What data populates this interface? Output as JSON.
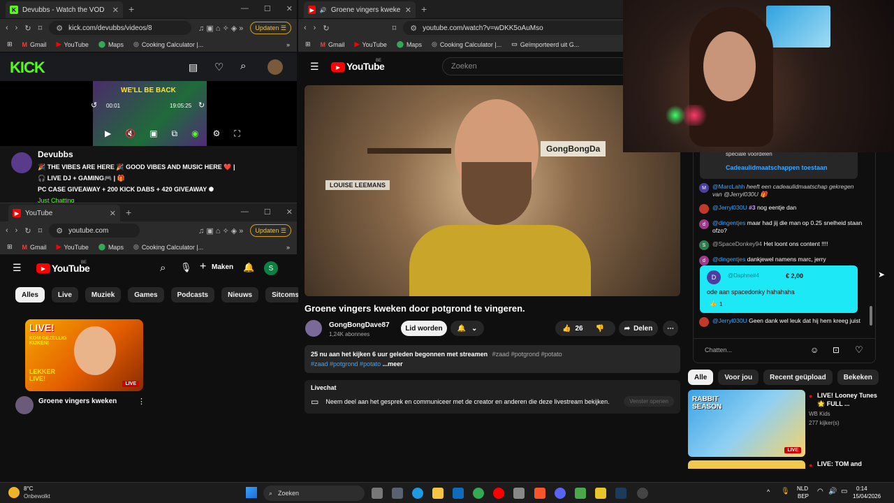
{
  "kick_window": {
    "tab_title": "Devubbs - Watch the VOD on Ki",
    "url": "kick.com/devubbs/videos/8",
    "update_label": "Updaten",
    "bookmarks": [
      "Gmail",
      "YouTube",
      "Maps",
      "Cooking Calculator |..."
    ],
    "logo": "KICK",
    "player_time_left": "00:01",
    "player_time_right": "19:05:25",
    "overlay_text": "WE'LL BE BACK",
    "channel_name": "Devubbs",
    "title_line1": "🎉 THE VIBES ARE HERE 🎉 GOOD VIBES AND MUSIC HERE ❤️ |",
    "title_line2": "🎧 LIVE DJ + GAMING🎮 | 🎁",
    "title_line3": "PC CASE GIVEAWAY + 200 KICK DABS + 420 GIVEAWAY ✺",
    "just_chatting": "Just Chatting"
  },
  "yt_small_window": {
    "tab_title": "YouTube",
    "url": "youtube.com",
    "update_label": "Updaten",
    "bookmarks": [
      "Gmail",
      "YouTube",
      "Maps",
      "Cooking Calculator |..."
    ],
    "logo": "YouTube",
    "logo_region": "BE",
    "create_label": "Maken",
    "avatar_letter": "S",
    "chips": [
      "Alles",
      "Live",
      "Muziek",
      "Games",
      "Podcasts",
      "Nieuws",
      "Sitcoms"
    ],
    "thumb_text_top": "LIVE!",
    "thumb_text_mid": "KOM GEZELLIG KIJKEN!",
    "thumb_text_bottom": "LEKKER LIVE!",
    "thumb_badge": "LIVE",
    "video_title": "Groene vingers kweken"
  },
  "yt_main_window": {
    "tab_title": "Groene vingers kweken door",
    "url": "youtube.com/watch?v=wDKK5oAuMso",
    "bookmarks": [
      "Gmail",
      "YouTube",
      "Maps",
      "Cooking Calculator |...",
      "Geïmporteerd uit G..."
    ],
    "logo": "YouTube",
    "logo_region": "BE",
    "search_placeholder": "Zoeken",
    "video_title": "Groene vingers kweken door potgrond te vingeren.",
    "channel_name": "GongBongDave87",
    "subscribers": "1,24K abonnees",
    "join_label": "Lid worden",
    "likes": "26",
    "share_label": "Delen",
    "desc_line1_stats": "25 nu aan het kijken  6 uur geleden begonnen met streamen",
    "desc_line1_tags": "#zaad #potgrond #potato",
    "desc_line2_tags": "#zaad #potgrond #potato",
    "desc_more": "...meer",
    "livechat_label": "Livechat",
    "livechat_text": "Neem deel aan het gesprek en communiceer met de creator en anderen die deze livestream bekijken.",
    "livechat_button": "Venster openen",
    "wall_sign_1": "LOUISE LEEMANS",
    "wall_sign_2": "GongBongDa"
  },
  "chat": {
    "gift_partial": "speciale voordelen",
    "gift_link": "Cadeaulidmaatschappen toestaan",
    "messages": [
      {
        "nick": "@MarcLahh",
        "text": "heeft een cadeaulidmaatschap gekregen van @Jerryl030U 🎁",
        "color": "#6b5fc7",
        "letter": "M"
      },
      {
        "nick": "@Jerryl030U",
        "badge": "#3",
        "text": "nog eentje dan",
        "color": "#c0392b",
        "letter": ""
      },
      {
        "nick": "@dingentjes",
        "text": "maar had jij die man op 0.25 snelheid staan ofzo?",
        "color": "#9b3b8a",
        "letter": "d"
      },
      {
        "nick": "@SpaceDonkey94",
        "text": "Het loont ons content !!!!",
        "color": "#2e7d4f",
        "letter": "S"
      },
      {
        "nick": "@dingentjes",
        "text": "dankjewel namens marc, jerry",
        "color": "#9b3b8a",
        "letter": "d"
      }
    ],
    "superchat": {
      "nick": "@Daphne#4",
      "amount": "€ 2,00",
      "text": "ode aan spacedonky hahahaha",
      "likes": "1",
      "letter": "D"
    },
    "last_message": {
      "nick": "@Jerryl030U",
      "text": "Geen dank wel leuk dat hij hem kreeg juist"
    },
    "input_placeholder": "Chatten..."
  },
  "related": {
    "chips": [
      "Alle",
      "Voor jou",
      "Recent geüpload",
      "Bekeken"
    ],
    "items": [
      {
        "title": "LIVE! Looney Tunes 🌟 FULL ...",
        "channel": "WB Kids",
        "viewers": "277 kijker(s)",
        "badge": "LIVE",
        "thumb_text": "RABBIT SEASON"
      },
      {
        "title": "LIVE: TOM and",
        "channel": "",
        "viewers": "",
        "badge": "LIVE",
        "thumb_text": ""
      }
    ]
  },
  "taskbar": {
    "weather_temp": "8°C",
    "weather_desc": "Onbewolkt",
    "search_label": "Zoeken",
    "lang_top": "NLD",
    "lang_bottom": "BEP",
    "time": "0:14",
    "date": "15/04/2026"
  }
}
